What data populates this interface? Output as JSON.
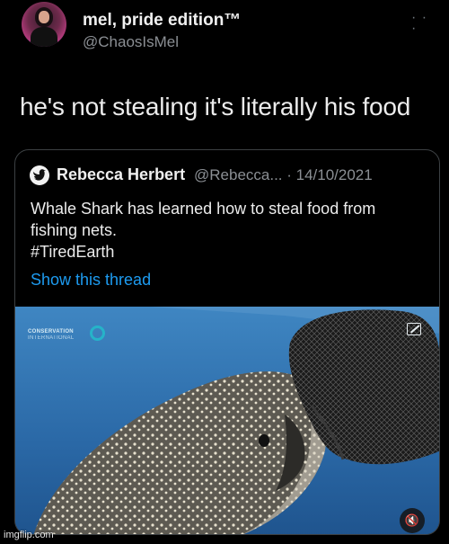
{
  "tweet": {
    "display_name": "mel, pride edition™",
    "handle": "@ChaosIsMel",
    "text": "he's not stealing it's literally his food",
    "more_icon": "more-options-icon"
  },
  "quote": {
    "name": "Rebecca Herbert",
    "handle_date": "@Rebecca... · 14/10/2021",
    "lines": [
      "Whale Shark has learned how to steal food from",
      "fishing nets.",
      "#TiredEarth"
    ],
    "show_thread": "Show this thread"
  },
  "media": {
    "logo_line1": "CONSERVATION",
    "logo_line2": "INTERNATIONAL",
    "mute_icon": "speaker-muted-icon",
    "mute_glyph": "🔇",
    "expand_icon": "expand-icon"
  },
  "watermark": "imgflip.com",
  "colors": {
    "background": "#000000",
    "link": "#1d9bf0",
    "secondary_text": "#8b8f94",
    "card_border": "#3c4043"
  }
}
